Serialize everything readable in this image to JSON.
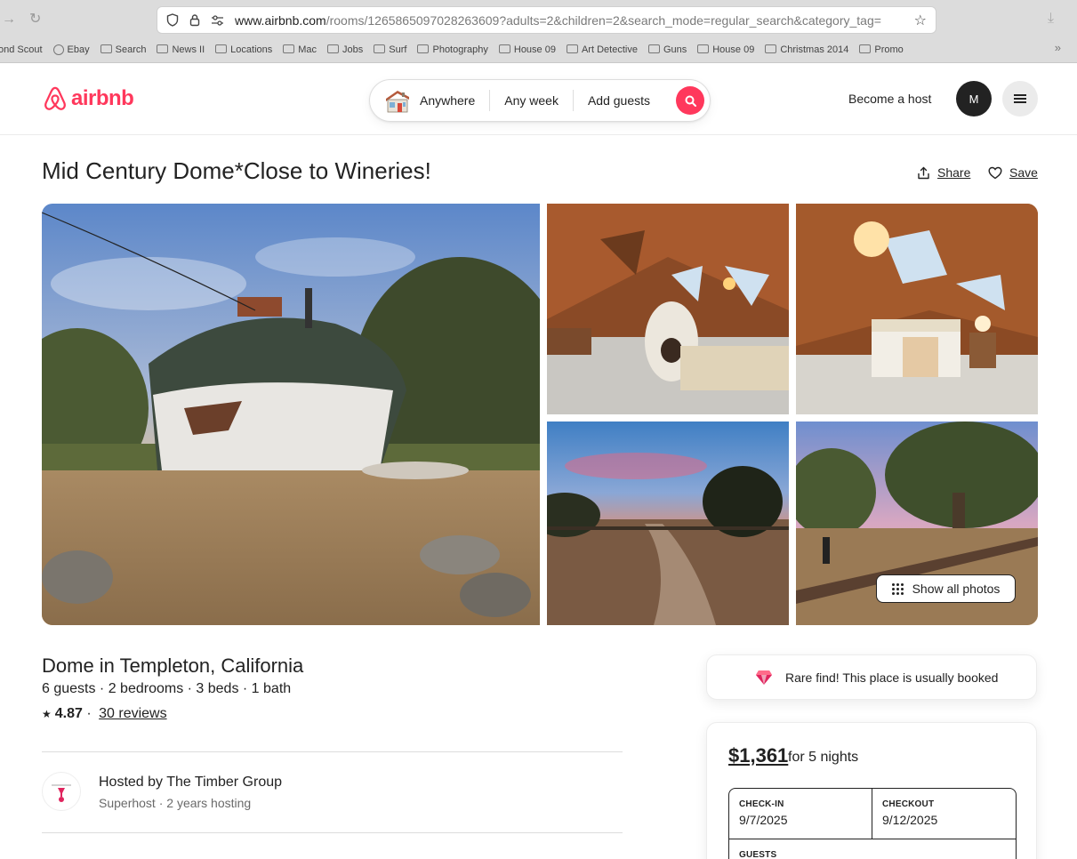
{
  "browser": {
    "url_domain": "www.airbnb.com",
    "url_path": "/rooms/1265865097028263609?adults=2&children=2&search_mode=regular_search&category_tag=",
    "bookmarks": [
      "ond Scout",
      "Ebay",
      "Search",
      "News II",
      "Locations",
      "Mac",
      "Jobs",
      "Surf",
      "Photography",
      "House 09",
      "Art Detective",
      "Guns",
      "House 09",
      "Christmas 2014",
      "Promo"
    ]
  },
  "header": {
    "logo_text": "airbnb",
    "search": {
      "where": "Anywhere",
      "when": "Any week",
      "who": "Add guests"
    },
    "become_host": "Become a host",
    "avatar_initial": "M"
  },
  "listing": {
    "title": "Mid Century Dome*Close to Wineries!",
    "share_label": "Share",
    "save_label": "Save",
    "show_all_photos": "Show all photos",
    "subtitle": "Dome in Templeton, California",
    "details": "6 guests · 2 bedrooms · 3 beds · 1 bath",
    "rating_star": "★",
    "rating": "4.87",
    "rating_sep": " · ",
    "reviews": "30 reviews",
    "host": {
      "name": "Hosted by The Timber Group",
      "meta": "Superhost · 2 years hosting"
    }
  },
  "booking": {
    "rare_find": "Rare find! This place is usually booked",
    "price": "$1,361",
    "price_suffix": "for 5 nights",
    "checkin_label": "CHECK-IN",
    "checkin_value": "9/7/2025",
    "checkout_label": "CHECKOUT",
    "checkout_value": "9/12/2025",
    "guests_label": "GUESTS"
  },
  "colors": {
    "brand": "#ff385c",
    "text": "#222222",
    "muted": "#6a6a6a"
  }
}
